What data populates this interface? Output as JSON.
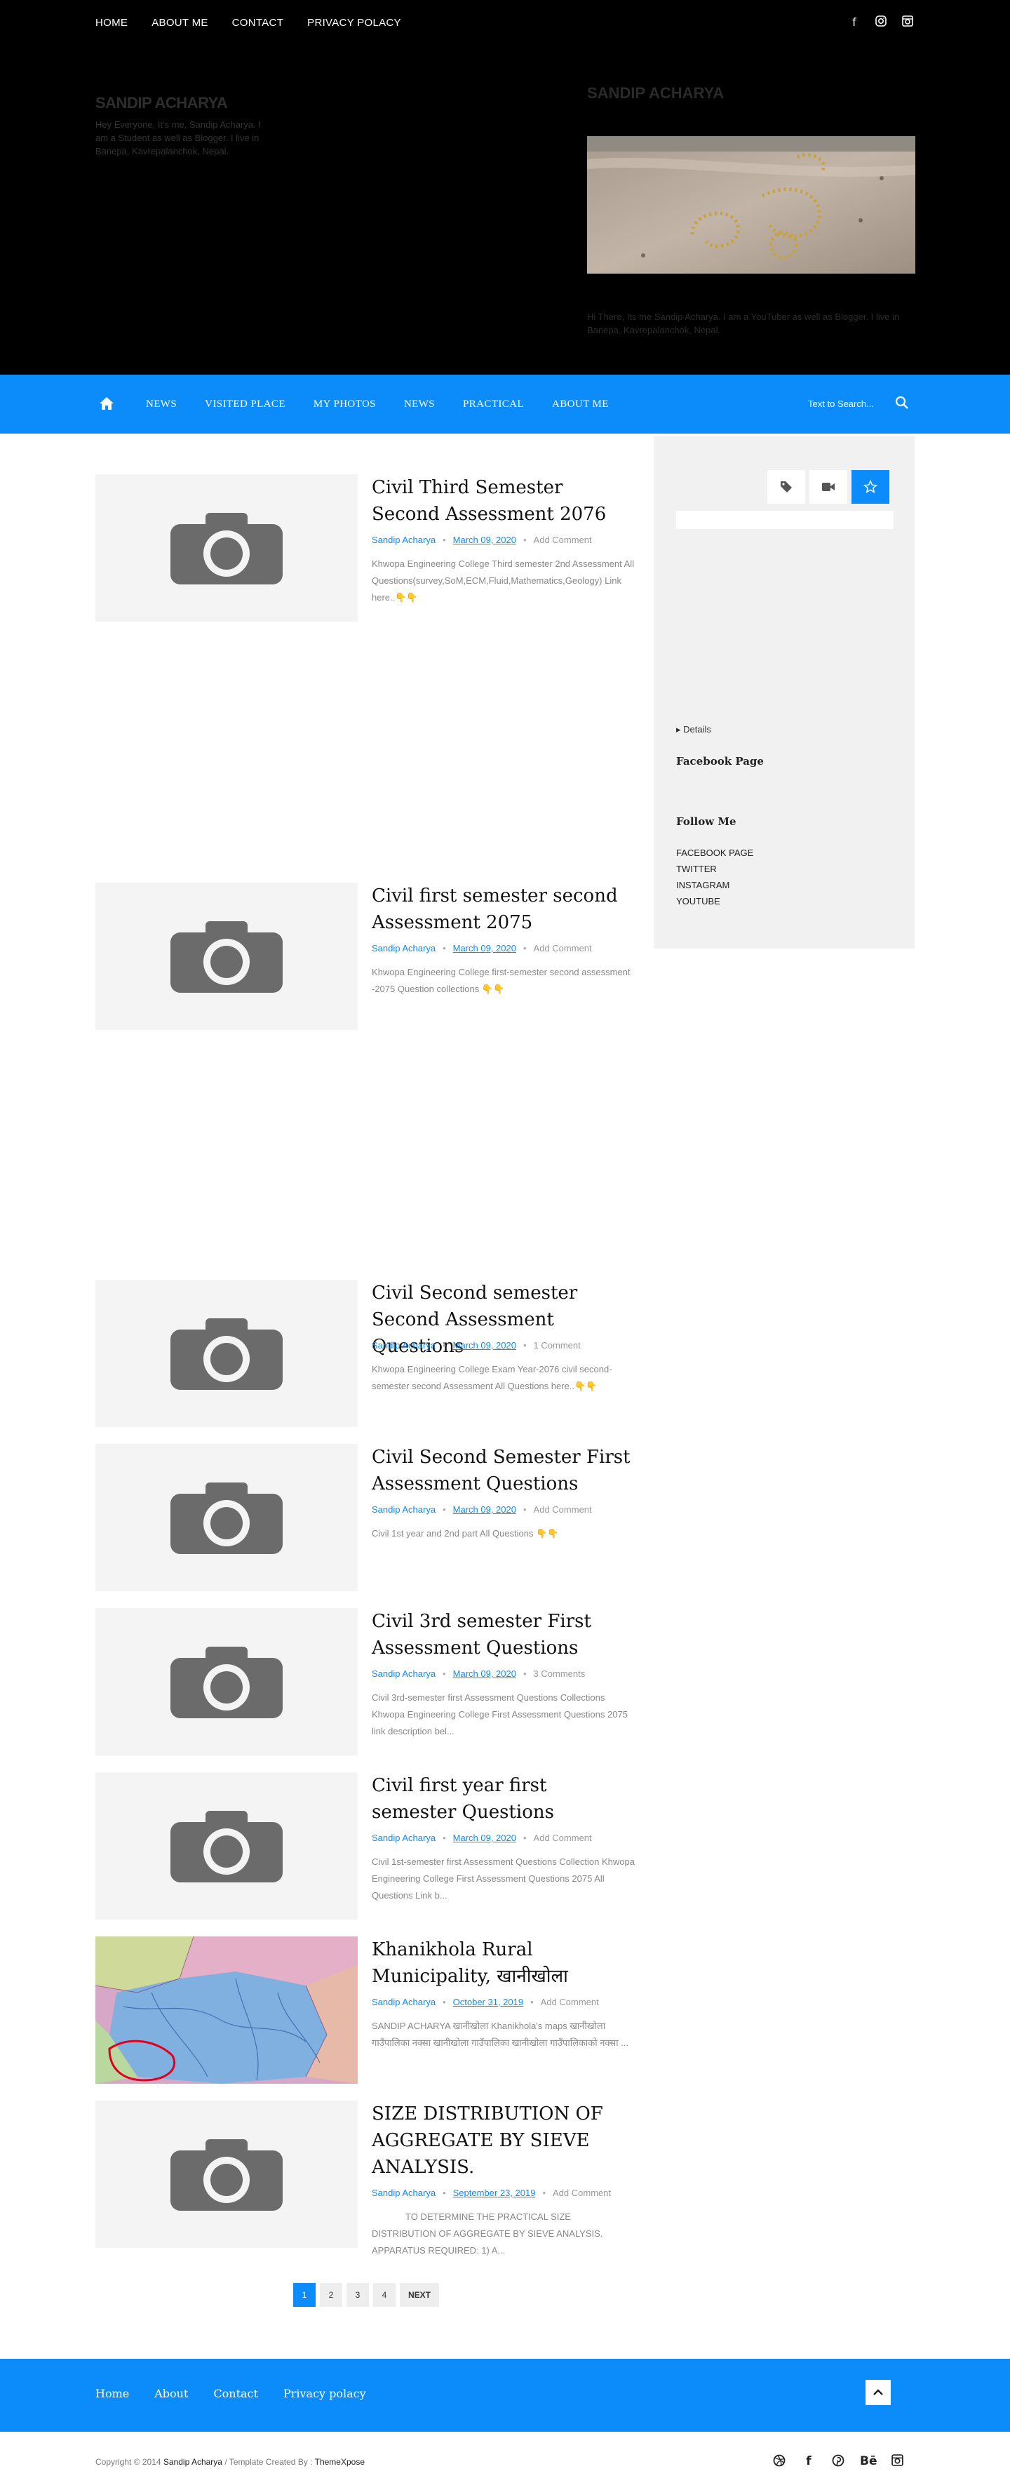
{
  "topbar": {
    "nav": [
      "HOME",
      "ABOUT ME",
      "CONTACT",
      "PRIVACY POLACY"
    ],
    "social_icons": [
      "facebook-icon",
      "instagram-icon",
      "instagram-icon"
    ]
  },
  "header": {
    "site_title": "SANDIP ACHARYA",
    "site_description": "Hey Everyone, It's me, Sandip Acharya. I am a Student as well as Blogger. I live in Banepa, Kavrepalanchok, Nepal.",
    "widget_title": "SANDIP ACHARYA",
    "widget_text": "Hi There, Its me Sandip Acharya. I am a YouTuber as well as Blogger. I live in Banepa, Kavrepalanchok, Nepal."
  },
  "mainnav": {
    "items": [
      "NEWS",
      "VISITED PLACE",
      "MY PHOTOS",
      "NEWS",
      "PRACTICAL",
      "ABOUT ME"
    ],
    "search_placeholder": "Text to Search..."
  },
  "posts": [
    {
      "title": "Civil Third Semester Second Assessment 2076",
      "author": "Sandip Acharya",
      "date": "March 09, 2020",
      "comments": "Add Comment",
      "excerpt": "Khwopa Engineering  College Third semester 2nd Assessment All Questions(survey,SoM,ECM,Fluid,Mathematics,Geology) Link here..👇👇"
    },
    {
      "title": "Civil first semester second Assessment 2075",
      "author": "Sandip Acharya",
      "date": "March 09, 2020",
      "comments": "Add Comment",
      "excerpt": "Khwopa Engineering  College first-semester second assessment -2075 Question collections 👇👇"
    },
    {
      "title": "Civil Second semester Second Assessment Questions",
      "author": "Sandip Acharya",
      "date": "March 09, 2020",
      "comments": "1 Comment",
      "excerpt": "Khwopa Engineering College Exam Year-2076 civil second-semester second Assessment All Questions here..👇👇"
    },
    {
      "title": "Civil Second Semester First Assessment Questions",
      "author": "Sandip Acharya",
      "date": "March 09, 2020",
      "comments": "Add Comment",
      "excerpt": "Civil 1st year and 2nd part All Questions 👇👇"
    },
    {
      "title": "Civil 3rd semester First Assessment Questions",
      "author": "Sandip Acharya",
      "date": "March 09, 2020",
      "comments": "3 Comments",
      "excerpt": "Civil 3rd-semester first Assessment Questions Collections Khwopa Engineering College First Assessment Questions 2075 link description bel..."
    },
    {
      "title": "Civil first year first semester Questions",
      "author": "Sandip Acharya",
      "date": "March 09, 2020",
      "comments": "Add Comment",
      "excerpt": "Civil 1st-semester first Assessment Questions Collection Khwopa Engineering College First Assessment Questions 2075 All Questions Link b..."
    },
    {
      "title": "Khanikhola Rural Municipality, खानीखोला",
      "author": "Sandip Acharya",
      "date": "October 31, 2019",
      "comments": "Add Comment",
      "excerpt": "SANDIP ACHARYA खानीखोला Khanikhola's maps खानीखोला गाउँपालिका नक्सा खानीखोला गाउँपालिका खानीखोला गाउँपालिकाको नक्सा ..."
    },
    {
      "title": "SIZE DISTRIBUTION OF AGGREGATE BY SIEVE ANALYSIS.",
      "author": "Sandip Acharya",
      "date": "September 23, 2019",
      "comments": "Add Comment",
      "excerpt": "TO DETERMINE THE PRACTICAL SIZE DISTRIBUTION OF AGGREGATE BY SIEVE ANALYSIS. APPARATUS REQUIRED: 1)     A..."
    }
  ],
  "sidebar": {
    "tabs": [
      "tag-icon",
      "video-icon",
      "star-icon"
    ],
    "details_label": "▸ Details",
    "facebook_heading": "Facebook Page",
    "follow_heading": "Follow Me",
    "follow_links": [
      "FACEBOOK PAGE",
      "TWITTER",
      "INSTAGRAM",
      "YOUTUBE"
    ]
  },
  "pagination": {
    "pages": [
      "1",
      "2",
      "3",
      "4"
    ],
    "active": "1",
    "next_label": "NEXT"
  },
  "footer": {
    "links": [
      "Home",
      "About",
      "Contact",
      "Privacy polacy"
    ],
    "copyright_prefix": "Copyright © 2014",
    "copyright_owner": "Sandip Acharya",
    "template_by": "/ Template Created By :",
    "template_author": "ThemeXpose",
    "social_icons": [
      "dribbble-icon",
      "facebook-icon",
      "pinterest-icon",
      "behance-icon",
      "instagram-icon"
    ]
  },
  "colors": {
    "accent": "#0c8cfa",
    "header_bg": "#000000",
    "sidebar_bg": "#f1f1f1"
  }
}
